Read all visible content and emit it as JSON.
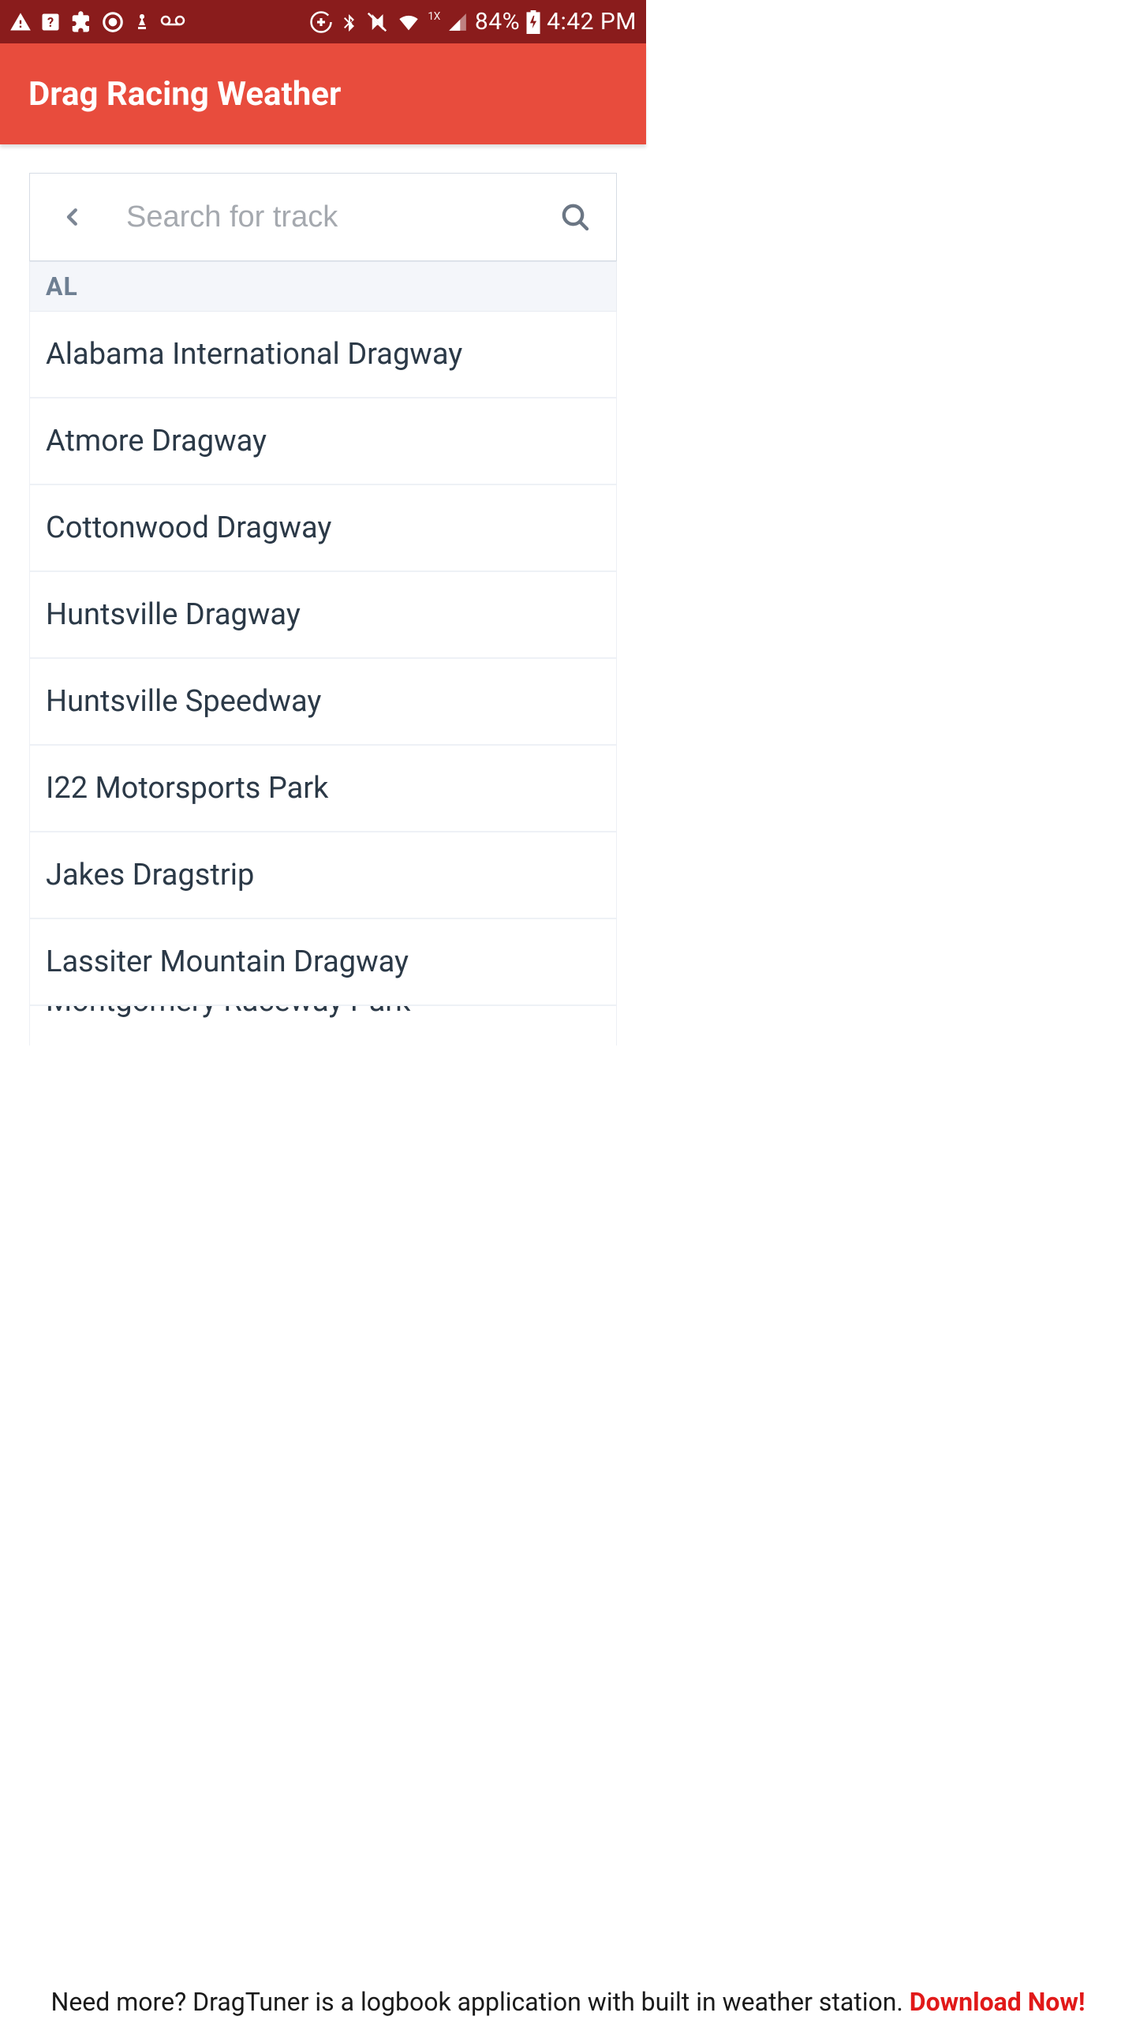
{
  "statusbar": {
    "network_label": "1X",
    "battery_pct": "84%",
    "clock": "4:42 PM"
  },
  "appbar": {
    "title": "Drag Racing Weather"
  },
  "search": {
    "placeholder": "Search for track"
  },
  "section": {
    "header": "AL"
  },
  "tracks": [
    "Alabama International Dragway",
    "Atmore Dragway",
    "Cottonwood Dragway",
    "Huntsville Dragway",
    "Huntsville Speedway",
    "I22 Motorsports Park",
    "Jakes Dragstrip",
    "Lassiter Mountain Dragway",
    "Montgomery Raceway Park"
  ],
  "footer": {
    "lead": "Need more? DragTuner is a logbook application with built in weather station. ",
    "cta": "Download Now!"
  }
}
